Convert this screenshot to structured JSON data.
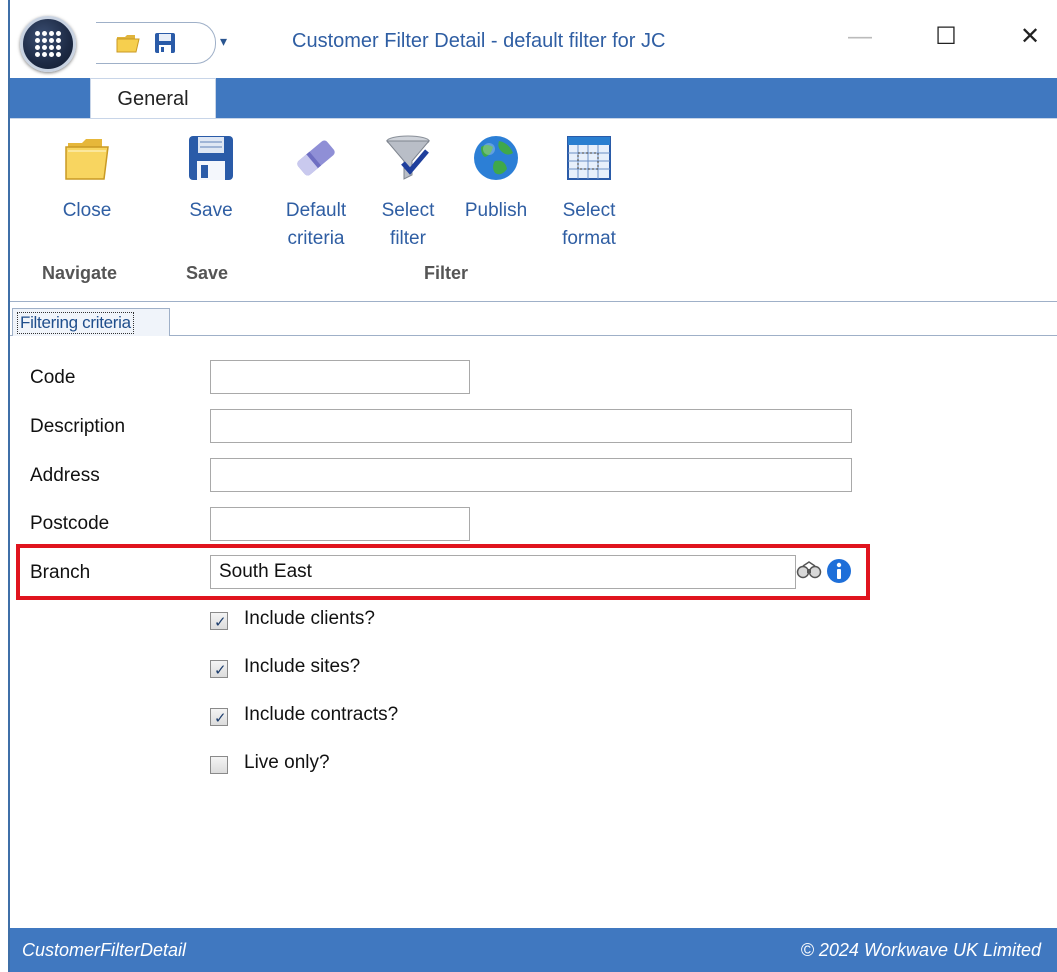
{
  "window": {
    "title": "Customer Filter Detail - default filter for JC",
    "minimize_glyph": "—",
    "maximize_glyph": "☐",
    "close_glyph": "✕",
    "qat_dropdown_glyph": "▾"
  },
  "ribbon": {
    "tabs": [
      {
        "label": "General",
        "selected": true
      }
    ],
    "buttons": {
      "close": {
        "label": "Close",
        "icon": "folder-icon"
      },
      "save": {
        "label": "Save",
        "icon": "save-disk-icon"
      },
      "default_criteria": {
        "label_line1": "Default",
        "label_line2": "criteria",
        "icon": "eraser-icon"
      },
      "select_filter": {
        "label_line1": "Select",
        "label_line2": "filter",
        "icon": "funnel-check-icon"
      },
      "publish": {
        "label": "Publish",
        "icon": "globe-icon"
      },
      "select_format": {
        "label_line1": "Select",
        "label_line2": "format",
        "icon": "grid-format-icon"
      }
    },
    "groups": {
      "navigate": "Navigate",
      "save": "Save",
      "filter": "Filter"
    }
  },
  "section_tab": "Filtering criteria",
  "form": {
    "code": {
      "label": "Code",
      "value": ""
    },
    "description": {
      "label": "Description",
      "value": ""
    },
    "address": {
      "label": "Address",
      "value": ""
    },
    "postcode": {
      "label": "Postcode",
      "value": ""
    },
    "branch": {
      "label": "Branch",
      "value": "South East",
      "highlight_color": "#e0141e"
    },
    "checkboxes": [
      {
        "label": "Include clients?",
        "checked": true
      },
      {
        "label": "Include sites?",
        "checked": true
      },
      {
        "label": "Include contracts?",
        "checked": true
      },
      {
        "label": "Live only?",
        "checked": false
      }
    ]
  },
  "statusbar": {
    "left": "CustomerFilterDetail",
    "right": "© 2024 Workwave UK Limited"
  },
  "colors": {
    "accent": "#4078c0",
    "title_text": "#2f5ea3",
    "highlight": "#e0141e"
  }
}
